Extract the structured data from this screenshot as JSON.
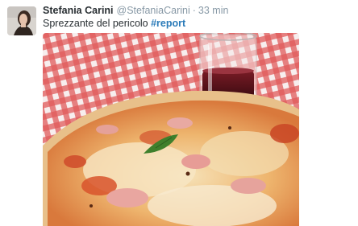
{
  "tweet": {
    "author_name": "Stefania Carini",
    "author_handle": "@StefaniaCarini",
    "separator": "·",
    "timestamp": "33 min",
    "text": "Sprezzante del pericolo ",
    "hashtag": "#report"
  },
  "icons": {
    "avatar": "profile-photo",
    "photo": "pizza-and-wine-photo"
  },
  "colors": {
    "name": "#292f33",
    "secondary": "#8899a6",
    "hashtag": "#2b7bb9",
    "tablecloth_red": "#e04a4a"
  }
}
